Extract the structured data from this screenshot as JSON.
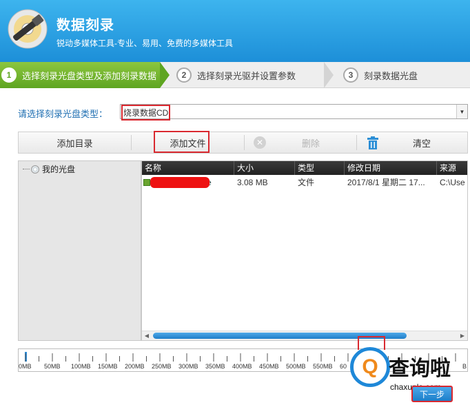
{
  "app": {
    "title": "数据刻录",
    "subtitle": "锐动多媒体工具-专业、易用、免费的多媒体工具"
  },
  "steps": [
    {
      "num": "1",
      "label": "选择刻录光盘类型及添加刻录数据"
    },
    {
      "num": "2",
      "label": "选择刻录光驱并设置参数"
    },
    {
      "num": "3",
      "label": "刻录数据光盘"
    }
  ],
  "disc_type": {
    "label": "请选择刻录光盘类型：",
    "value": "烧录数据CD"
  },
  "toolbar": {
    "add_dir": "添加目录",
    "add_file": "添加文件",
    "delete": "删除",
    "clear": "清空"
  },
  "tree": {
    "root": "我的光盘"
  },
  "files": {
    "columns": [
      "名称",
      "大小",
      "类型",
      "修改日期",
      "来源"
    ],
    "rows": [
      {
        "name": "e",
        "size": "3.08 MB",
        "type": "文件",
        "modified": "2017/8/1 星期二 17...",
        "source": "C:\\Use"
      }
    ]
  },
  "capacity": {
    "ticks": [
      "0MB",
      "50MB",
      "100MB",
      "150MB",
      "200MB",
      "250MB",
      "300MB",
      "350MB",
      "400MB",
      "450MB",
      "500MB",
      "550MB",
      "60"
    ],
    "end_label": "B",
    "used_fraction": 0.005
  },
  "watermark": {
    "glyph": "Q",
    "text": "查询啦",
    "domain": "chaxunla.com"
  },
  "next_button": "下一步"
}
